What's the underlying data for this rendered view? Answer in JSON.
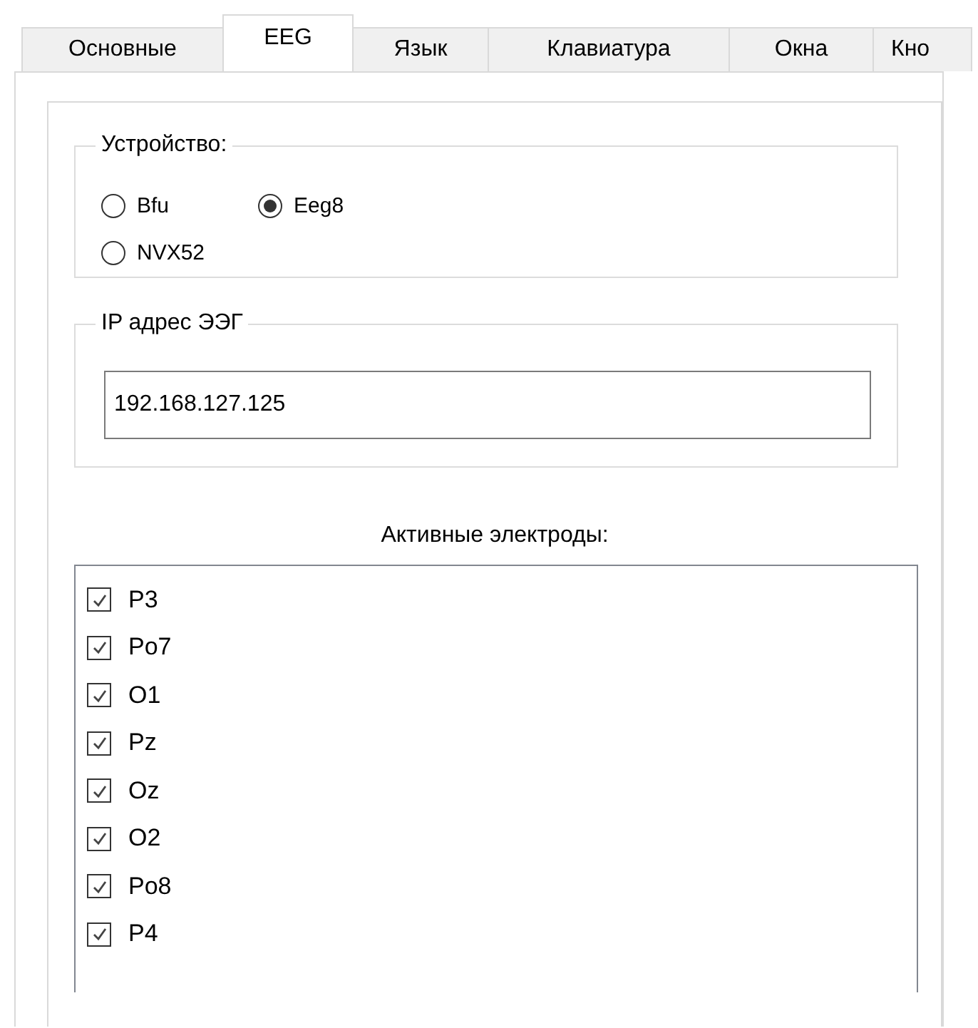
{
  "tabs": [
    {
      "label": "Основные",
      "selected": false
    },
    {
      "label": "EEG",
      "selected": true
    },
    {
      "label": "Язык",
      "selected": false
    },
    {
      "label": "Клавиатура",
      "selected": false
    },
    {
      "label": "Окна",
      "selected": false
    },
    {
      "label": "Кно",
      "selected": false
    }
  ],
  "device_group": {
    "title": "Устройство:",
    "options": [
      {
        "label": "Bfu",
        "selected": false
      },
      {
        "label": "Eeg8",
        "selected": true
      },
      {
        "label": "NVX52",
        "selected": false
      }
    ]
  },
  "ip_group": {
    "title": "IP адрес ЭЭГ",
    "value": "192.168.127.125"
  },
  "electrodes": {
    "title": "Активные электроды:",
    "items": [
      {
        "label": "P3",
        "checked": true
      },
      {
        "label": "Po7",
        "checked": true
      },
      {
        "label": "O1",
        "checked": true
      },
      {
        "label": "Pz",
        "checked": true
      },
      {
        "label": "Oz",
        "checked": true
      },
      {
        "label": "O2",
        "checked": true
      },
      {
        "label": "Po8",
        "checked": true
      },
      {
        "label": "P4",
        "checked": true
      }
    ]
  }
}
